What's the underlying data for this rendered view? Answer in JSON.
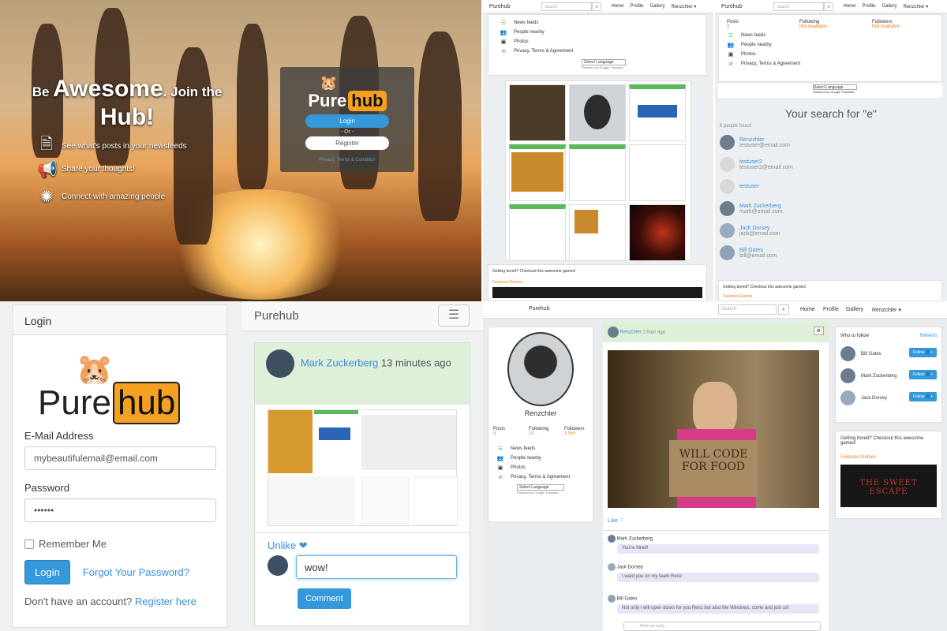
{
  "hero": {
    "tagline_pre": "Be",
    "tagline_big": "Awesome",
    "tagline_post": ". Join the",
    "tagline_hub": "Hub!",
    "features": [
      "See what's posts in your newsfeeds",
      "Share your thoughts!",
      "Connect with amazing people"
    ],
    "logo_pure": "Pure",
    "logo_hub": "hub",
    "login_label": "Login",
    "or_label": "- Or -",
    "register_label": "Register",
    "footer_link": "Privacy, Terms & Condition"
  },
  "top_middle": {
    "brand": "Purehub",
    "search_placeholder": "Search",
    "nav": [
      "Home",
      "Profile",
      "Gallery",
      "Renzchler ▾"
    ],
    "menu": [
      "News feeds",
      "People nearby",
      "Photos",
      "Privacy, Terms & Agreement"
    ],
    "select_language": "Select Language",
    "powered_by": "Powered by Google Translate",
    "games_text": "Getting bored? Checkout this awesome games!",
    "featured_games": "Featured Games"
  },
  "top_right": {
    "brand": "Purehub",
    "search_placeholder": "Search",
    "nav": [
      "Home",
      "Profile",
      "Gallery",
      "Renzchler ▾"
    ],
    "stats": [
      {
        "label": "Posts",
        "value": "3"
      },
      {
        "label": "Following",
        "value": "Not Available"
      },
      {
        "label": "Followers",
        "value": "Not Available"
      }
    ],
    "menu": [
      "News feeds",
      "People nearby",
      "Photos",
      "Privacy, Terms & Agreement"
    ],
    "select_language": "Select Language",
    "powered_by": "Powered by Google Translate",
    "search_heading": "Your search for \"e\"",
    "people_found": "6 people found",
    "people": [
      {
        "name": "Renzchler",
        "email": "testuser@email.com"
      },
      {
        "name": "testuser2",
        "email": "testuser2@email.com"
      },
      {
        "name": "testuser",
        "email": ""
      },
      {
        "name": "Mark Zuckerberg",
        "email": "mark@email.com"
      },
      {
        "name": "Jack Dorsey",
        "email": "jack@email.com"
      },
      {
        "name": "Bill Gates",
        "email": "bill@email.com"
      }
    ],
    "games_text": "Getting bored? Checkout this awesome games!",
    "featured_games": "Featured Games"
  },
  "login": {
    "header": "Login",
    "logo_pure": "Pure",
    "logo_hub": "hub",
    "email_label": "E-Mail Address",
    "email_value": "mybeautifulemail@email.com",
    "password_label": "Password",
    "password_value": "••••••",
    "remember_label": "Remember Me",
    "login_button": "Login",
    "forgot_link": "Forgot Your Password?",
    "no_account": "Don't have an account?",
    "register_link": "Register here"
  },
  "feed": {
    "brand": "Purehub",
    "author": "Mark Zuckerberg",
    "time": "13 minutes ago",
    "unlike_label": "Unlike",
    "comment_value": "wow!",
    "comment_button": "Comment"
  },
  "profile": {
    "brand": "Purehub",
    "search_placeholder": "Search",
    "nav": [
      "Home",
      "Profile",
      "Gallery",
      "Renzchler ▾"
    ],
    "name": "Renzchler",
    "stats": [
      {
        "label": "Posts",
        "value": "3"
      },
      {
        "label": "Following",
        "value": "10"
      },
      {
        "label": "Followers",
        "value": "1.5m"
      }
    ],
    "menu": [
      "News feeds",
      "People nearby",
      "Photos",
      "Privacy, Terms & Agreement"
    ],
    "select_language": "Select Language",
    "powered_by": "Powered by Google Translate",
    "post_author": "Renzchler",
    "post_time": "1 hour ago",
    "photo_sign": "WILL CODE FOR FOOD",
    "like_label": "Like ♡",
    "comments": [
      {
        "name": "Mark Zuckerberg",
        "text": "You're hired!"
      },
      {
        "name": "Jack Dorsey",
        "text": "I want you on my team Renz"
      },
      {
        "name": "Bill Gates",
        "text": "Not only I will open doors for you Renz but also the Windows, come and join us!"
      }
    ],
    "comment_placeholder": "Write an reply...",
    "who_to_follow": "Who to follow",
    "refresh": "Refresh",
    "suggestions": [
      "Bill Gates",
      "Mark Zuckerberg",
      "Jack Dorsey"
    ],
    "follow_label": "Follow",
    "games_text": "Getting bored? Checkout this awesome games!",
    "featured_games": "Featured Games",
    "game_title": "THE SWEET ESCAPE"
  },
  "colors": {
    "accent": "#3498db",
    "orange": "#f07e1b",
    "green_header": "#dff0d8"
  }
}
